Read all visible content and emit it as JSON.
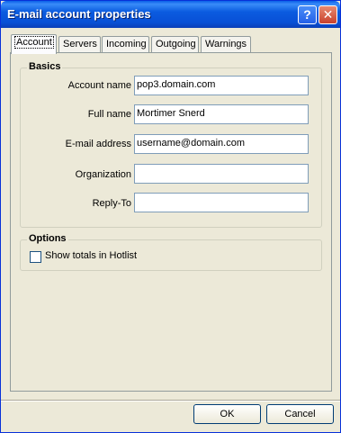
{
  "window": {
    "title": "E-mail account properties"
  },
  "titlebar": {
    "help_label": "?",
    "close_label": "✕"
  },
  "tabs": [
    {
      "label": "Account",
      "active": true
    },
    {
      "label": "Servers",
      "active": false
    },
    {
      "label": "Incoming",
      "active": false
    },
    {
      "label": "Outgoing",
      "active": false
    },
    {
      "label": "Warnings",
      "active": false
    }
  ],
  "basics": {
    "title": "Basics",
    "account_name": {
      "label": "Account name",
      "value": "pop3.domain.com"
    },
    "full_name": {
      "label": "Full name",
      "value": "Mortimer Snerd"
    },
    "email_address": {
      "label": "E-mail address",
      "value": "username@domain.com"
    },
    "organization": {
      "label": "Organization",
      "value": ""
    },
    "reply_to": {
      "label": "Reply-To",
      "value": ""
    }
  },
  "options": {
    "title": "Options",
    "show_totals": {
      "label": "Show totals in Hotlist",
      "checked": false
    }
  },
  "buttons": {
    "ok": "OK",
    "cancel": "Cancel"
  }
}
